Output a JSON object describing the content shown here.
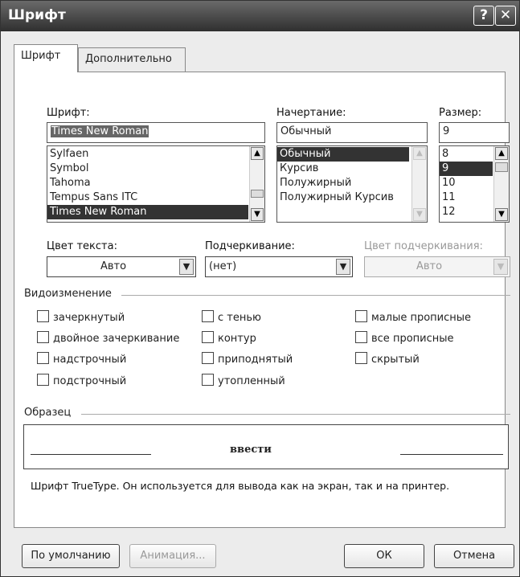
{
  "window": {
    "title": "Шрифт",
    "help_glyph": "?",
    "close_glyph": "✕"
  },
  "tabs": [
    {
      "label": "Шрифт"
    },
    {
      "label": "Дополнительно"
    }
  ],
  "font": {
    "label": "Шрифт:",
    "value": "Times New Roman",
    "list": [
      "Sylfaen",
      "Symbol",
      "Tahoma",
      "Tempus Sans ITC",
      "Times New Roman"
    ]
  },
  "style": {
    "label": "Начертание:",
    "value": "Обычный",
    "list": [
      "Обычный",
      "Курсив",
      "Полужирный",
      "Полужирный Курсив"
    ]
  },
  "size": {
    "label": "Размер:",
    "value": "9",
    "list": [
      "8",
      "9",
      "10",
      "11",
      "12"
    ]
  },
  "color": {
    "label": "Цвет текста:",
    "value": "Авто"
  },
  "underline": {
    "label": "Подчеркивание:",
    "value": "(нет)"
  },
  "underline_color": {
    "label": "Цвет подчеркивания:",
    "value": "Авто"
  },
  "effects": {
    "title": "Видоизменение",
    "items": [
      "зачеркнутый",
      "двойное зачеркивание",
      "надстрочный",
      "подстрочный",
      "с тенью",
      "контур",
      "приподнятый",
      "утопленный",
      "малые прописные",
      "все прописные",
      "скрытый"
    ]
  },
  "preview": {
    "title": "Образец",
    "sample": "ввести",
    "note": "Шрифт TrueType. Он используется для вывода как на экран, так и на принтер."
  },
  "buttons": {
    "default": "По умолчанию",
    "animation": "Анимация...",
    "ok": "ОК",
    "cancel": "Отмена"
  }
}
